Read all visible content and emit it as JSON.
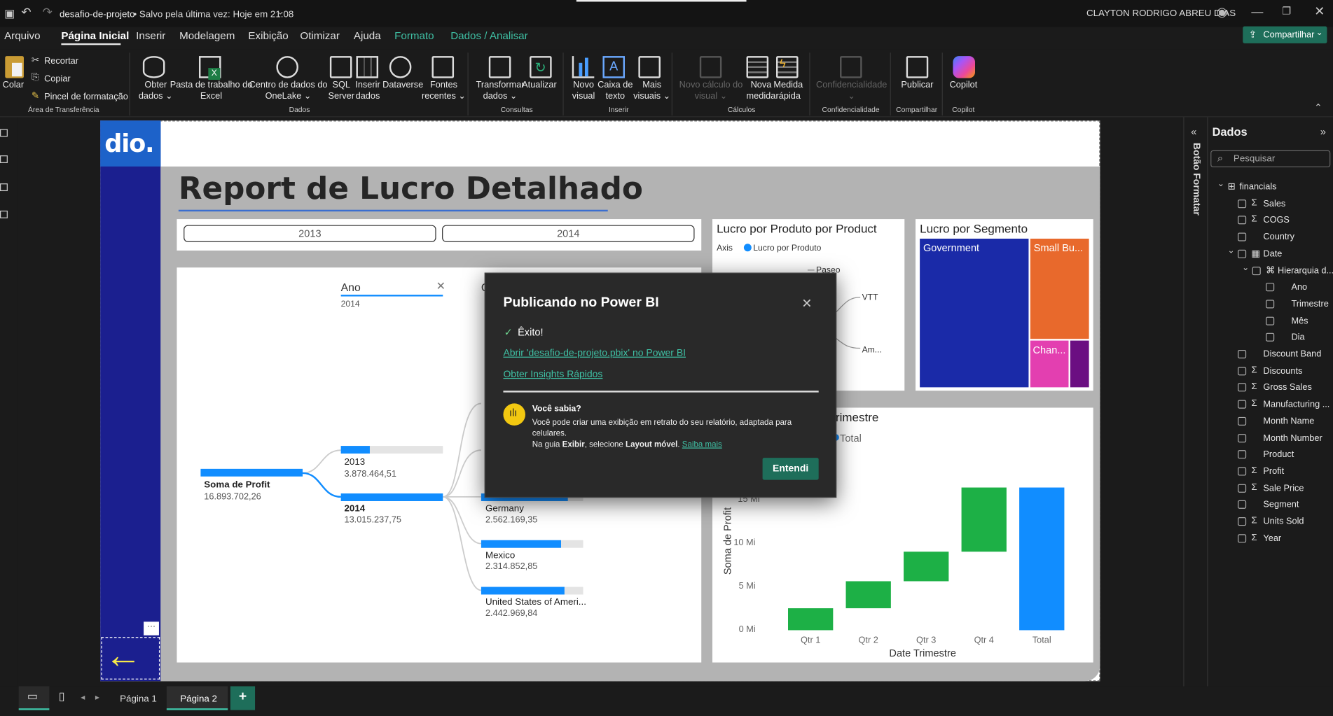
{
  "titlebar": {
    "file": "desafio-de-projeto",
    "status": "• Salvo pela última vez: Hoje em 21:08",
    "user": "CLAYTON RODRIGO ABREU DIAS"
  },
  "menu": [
    "Arquivo",
    "Página Inicial",
    "Inserir",
    "Modelagem",
    "Exibição",
    "Otimizar",
    "Ajuda",
    "Formato",
    "Dados / Analisar"
  ],
  "share": "Compartilhar",
  "ribbon": {
    "colar": "Colar",
    "recortar": "Recortar",
    "copiar": "Copiar",
    "pincel": "Pincel de formatação",
    "g_area": "Área de Transferência",
    "obter": "Obter",
    "obter2": "dados",
    "excel": "Pasta de trabalho do",
    "excel2": "Excel",
    "onelake": "Centro de dados do",
    "onelake2": "OneLake",
    "sql": "SQL",
    "sql2": "Server",
    "inserir": "Inserir",
    "inserir2": "dados",
    "dataverse": "Dataverse",
    "fontes": "Fontes",
    "fontes2": "recentes",
    "g_dados": "Dados",
    "transformar": "Transformar",
    "transformar2": "dados",
    "atualizar": "Atualizar",
    "g_consultas": "Consultas",
    "novo": "Novo",
    "novo2": "visual",
    "caixa": "Caixa de",
    "caixa2": "texto",
    "mais": "Mais",
    "mais2": "visuais",
    "g_inserir": "Inserir",
    "novocalc": "Novo cálculo do",
    "novocalc2": "visual",
    "novamed": "Nova",
    "novamed2": "medida",
    "medrap": "Medida",
    "medrap2": "rápida",
    "g_calculos": "Cálculos",
    "conf": "Confidencialidade",
    "g_conf": "Confidencialidade",
    "publicar": "Publicar",
    "g_comp": "Compartilhar",
    "copilot": "Copilot",
    "g_copilot": "Copilot"
  },
  "report": {
    "logo": "dio.",
    "title": "Report de Lucro Detalhado",
    "year1": "2013",
    "year2": "2014"
  },
  "decomp": {
    "level_label": "Ano",
    "level_value": "2014",
    "root_label": "Soma de Profit",
    "root_value": "16.893.702,26",
    "nodes": [
      {
        "label": "2013",
        "value": "3.878.464,51"
      },
      {
        "label": "2014",
        "value": "13.015.237,75"
      }
    ],
    "countries": [
      {
        "label": "Germany",
        "value": "2.562.169,35"
      },
      {
        "label": "Mexico",
        "value": "2.314.852,85"
      },
      {
        "label": "United States of Ameri...",
        "value": "2.442.969,84"
      }
    ]
  },
  "product_chart": {
    "title": "Lucro por Produto por Product",
    "axis": "Axis",
    "legend": "Lucro por Produto",
    "labels": [
      "Paseo",
      "VTT",
      "Am..."
    ]
  },
  "segment_chart": {
    "title": "Lucro por Segmento",
    "segments": [
      "Government",
      "Small Bu...",
      "Chan..."
    ]
  },
  "waterfall": {
    "title_partial": "rimestre",
    "legend": "Total",
    "ylabel": "Soma de Profit",
    "xlabel": "Date Trimestre",
    "yticks": [
      "15 Mi",
      "10 Mi",
      "5 Mi",
      "0 Mi"
    ]
  },
  "chart_data": {
    "type": "bar",
    "title": "",
    "categories": [
      "Qtr 1",
      "Qtr 2",
      "Qtr 3",
      "Qtr 4",
      "Total"
    ],
    "values": [
      2.6,
      3.2,
      3.5,
      7.6,
      16.9
    ],
    "ylabel": "Soma de Profit",
    "xlabel": "Date Trimestre",
    "ylim": [
      0,
      16.9
    ],
    "colors": {
      "increase": "#1db046",
      "total": "#118dff"
    }
  },
  "dialog": {
    "title": "Publicando no Power BI",
    "success": "Êxito!",
    "link1": "Abrir 'desafio-de-projeto.pbix' no Power BI",
    "link2": "Obter Insights Rápidos",
    "tip_title": "Você sabia?",
    "tip1": "Você pode criar uma exibição em retrato do seu relatório, adaptada para",
    "tip2": "celulares.",
    "tip3a": "Na guia ",
    "tip3b": "Exibir",
    "tip3c": ", selecione ",
    "tip3d": "Layout móvel",
    "tip3e": ".",
    "tip_link": "Saiba mais",
    "button": "Entendi"
  },
  "panel": {
    "title": "Dados",
    "search": "Pesquisar",
    "vtab": "Botão Formatar",
    "table": "financials",
    "fields": [
      "Sales",
      "COGS",
      "Country",
      "Date",
      "Hierarquia d...",
      "Ano",
      "Trimestre",
      "Mês",
      "Dia",
      "Discount Band",
      "Discounts",
      "Gross Sales",
      "Manufacturing ...",
      "Month Name",
      "Month Number",
      "Product",
      "Profit",
      "Sale Price",
      "Segment",
      "Units Sold",
      "Year"
    ]
  },
  "pages": [
    "Página 1",
    "Página 2"
  ]
}
